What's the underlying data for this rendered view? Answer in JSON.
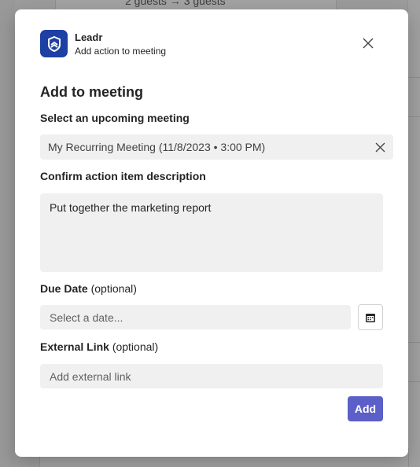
{
  "background": {
    "partial_text": "2 guests → 3 guests"
  },
  "dialog": {
    "app_name": "Leadr",
    "app_subtitle": "Add action to meeting",
    "title": "Add to meeting",
    "meeting": {
      "label": "Select an upcoming meeting",
      "value": "My Recurring Meeting (11/8/2023 • 3:00 PM)"
    },
    "description": {
      "label": "Confirm action item description",
      "value": "Put together the marketing report"
    },
    "due_date": {
      "label": "Due Date",
      "optional": "(optional)",
      "placeholder": "Select a date..."
    },
    "external_link": {
      "label": "External Link",
      "optional": "(optional)",
      "placeholder": "Add external link"
    },
    "add_label": "Add"
  },
  "colors": {
    "app_icon": "#1e3fa3",
    "primary_button": "#5b5fc7",
    "field_background": "#f0f0f0"
  },
  "icons": [
    "leadr-logo-icon",
    "close-icon",
    "clear-icon",
    "calendar-icon"
  ]
}
